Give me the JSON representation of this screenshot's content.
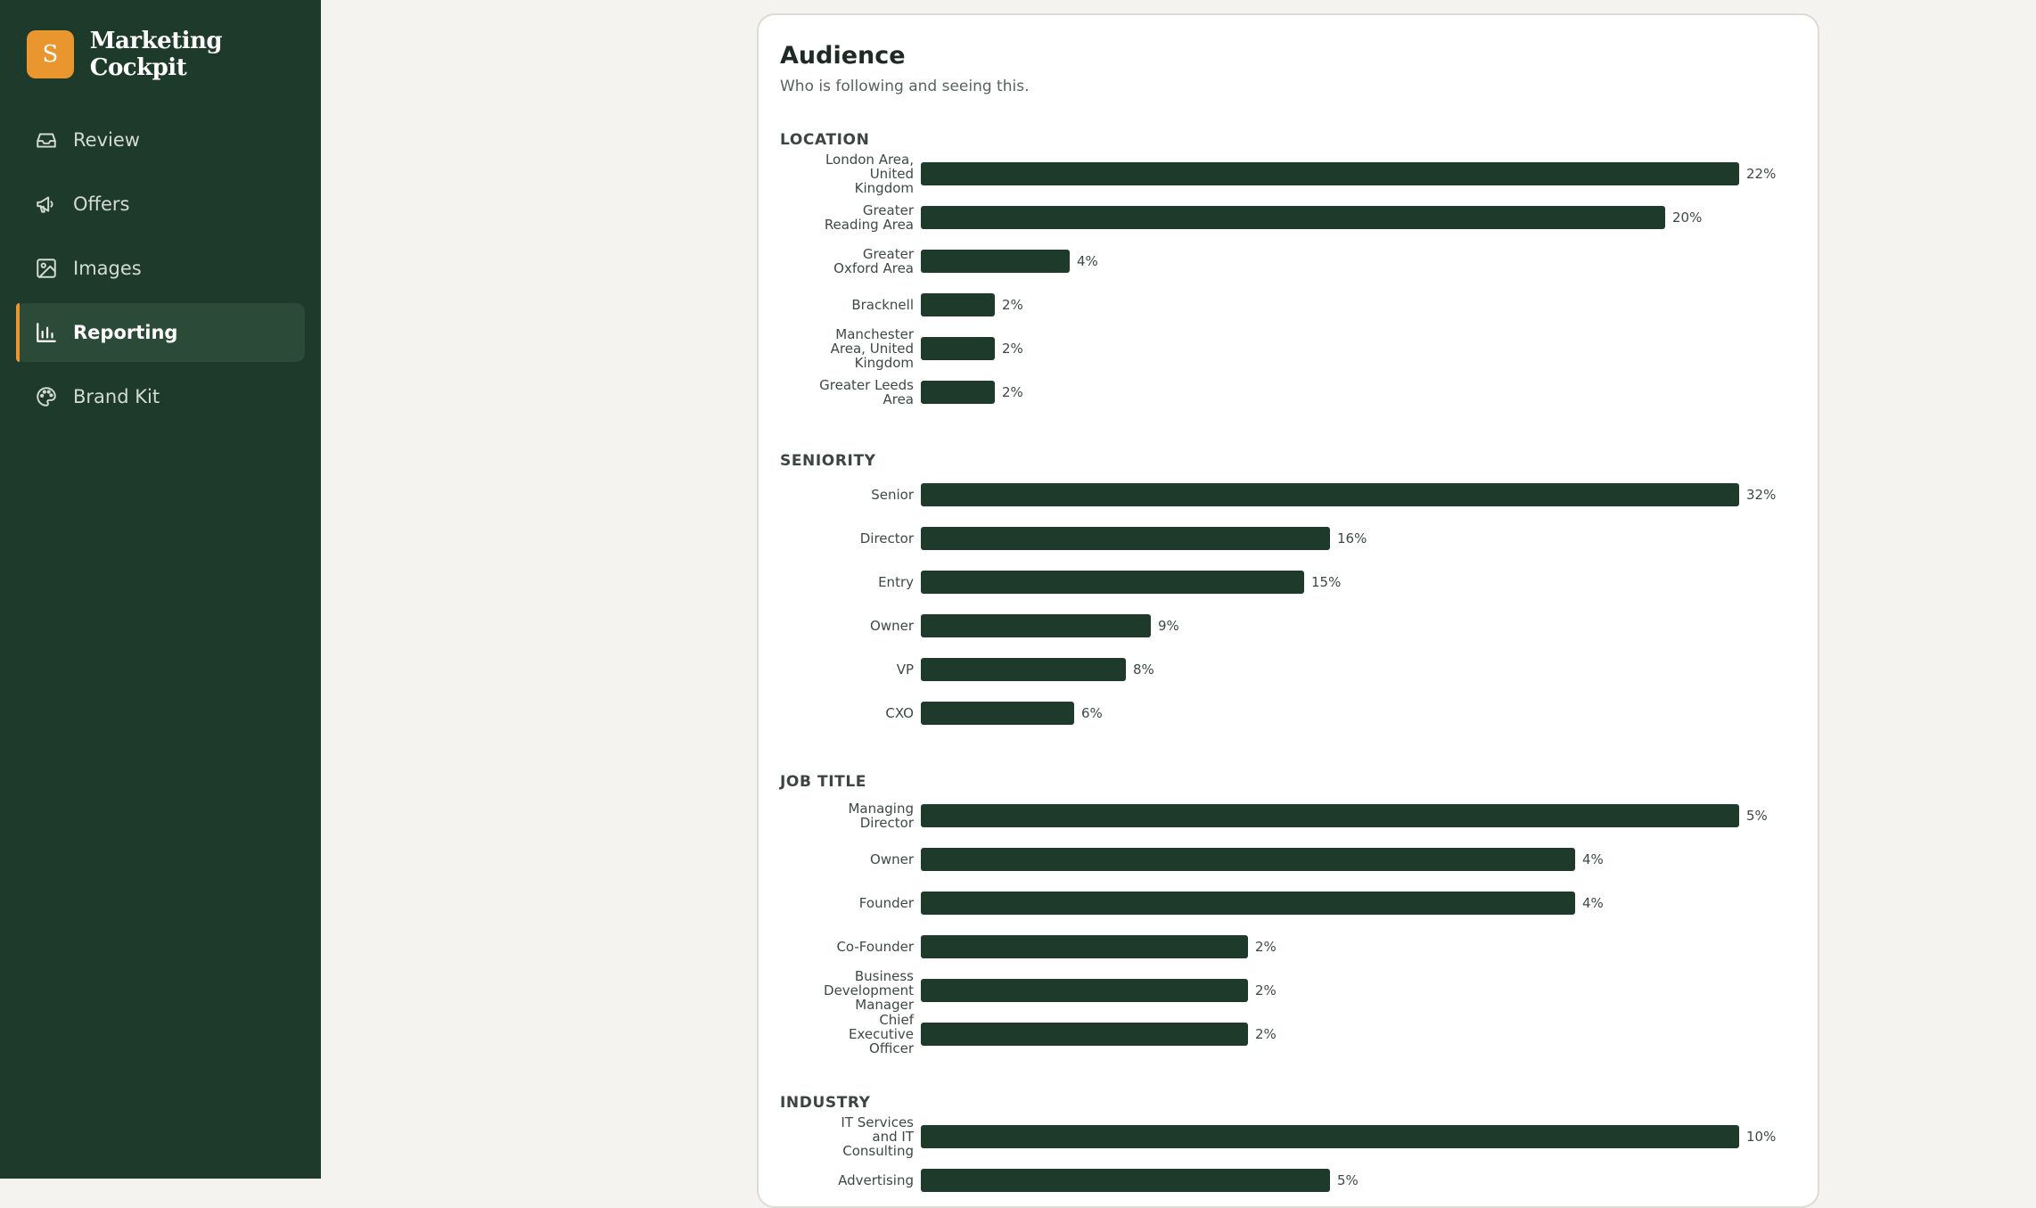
{
  "app": {
    "brand_initial": "S",
    "brand_name": "Marketing Cockpit"
  },
  "nav": [
    {
      "label": "Review",
      "icon": "inbox-icon",
      "active": false
    },
    {
      "label": "Offers",
      "icon": "megaphone-icon",
      "active": false
    },
    {
      "label": "Images",
      "icon": "image-icon",
      "active": false
    },
    {
      "label": "Reporting",
      "icon": "bar-chart-icon",
      "active": true
    },
    {
      "label": "Brand Kit",
      "icon": "palette-icon",
      "active": false
    }
  ],
  "audience": {
    "title": "Audience",
    "subtitle": "Who is following and seeing this."
  },
  "colors": {
    "sidebar": "#1e3a2a",
    "accent": "#e9962e",
    "bar": "#1e3a2a"
  },
  "chart_data": [
    {
      "type": "bar",
      "title": "LOCATION",
      "categories": [
        "London Area, United Kingdom",
        "Greater Reading Area",
        "Greater Oxford Area",
        "Bracknell",
        "Manchester Area, United Kingdom",
        "Greater Leeds Area"
      ],
      "values": [
        22,
        20,
        4,
        2,
        2,
        2
      ],
      "value_labels": [
        "22%",
        "20%",
        "4%",
        "2%",
        "2%",
        "2%"
      ],
      "unit": "%"
    },
    {
      "type": "bar",
      "title": "SENIORITY",
      "categories": [
        "Senior",
        "Director",
        "Entry",
        "Owner",
        "VP",
        "CXO"
      ],
      "values": [
        32,
        16,
        15,
        9,
        8,
        6
      ],
      "value_labels": [
        "32%",
        "16%",
        "15%",
        "9%",
        "8%",
        "6%"
      ],
      "unit": "%"
    },
    {
      "type": "bar",
      "title": "JOB TITLE",
      "categories": [
        "Managing Director",
        "Owner",
        "Founder",
        "Co-Founder",
        "Business Development Manager",
        "Chief Executive Officer"
      ],
      "values": [
        5,
        4,
        4,
        2,
        2,
        2
      ],
      "value_labels": [
        "5%",
        "4%",
        "4%",
        "2%",
        "2%",
        "2%"
      ],
      "unit": "%"
    },
    {
      "type": "bar",
      "title": "INDUSTRY",
      "categories": [
        "IT Services and IT Consulting",
        "Advertising"
      ],
      "values": [
        10,
        5
      ],
      "value_labels": [
        "10%",
        "5%"
      ],
      "unit": "%"
    }
  ]
}
